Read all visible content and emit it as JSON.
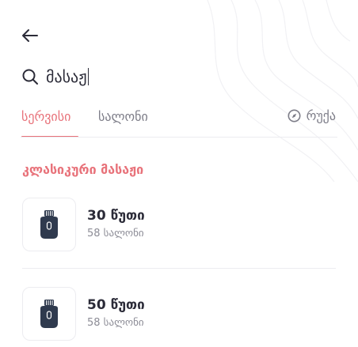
{
  "header": {
    "back_icon": "arrow-left-icon"
  },
  "search": {
    "icon": "search-icon",
    "value": "მასაჟ"
  },
  "tabs": [
    {
      "label": "სერვისი",
      "active": true
    },
    {
      "label": "სალონი",
      "active": false
    }
  ],
  "map_tab": {
    "label": "რუქა",
    "icon": "compass-icon"
  },
  "section": {
    "title": "კლასიკური მასაჟი"
  },
  "items": [
    {
      "title": "30 წუთი",
      "subtitle": "58 სალონი",
      "icon": "massager-device-icon"
    },
    {
      "title": "50 წუთი",
      "subtitle": "58 სალონი",
      "icon": "massager-device-icon"
    }
  ],
  "colors": {
    "accent": "#e8727a",
    "text": "#2b2b38",
    "muted": "#8c8c96",
    "icon_dark": "#2f3a4e",
    "divider": "#ececf0"
  }
}
